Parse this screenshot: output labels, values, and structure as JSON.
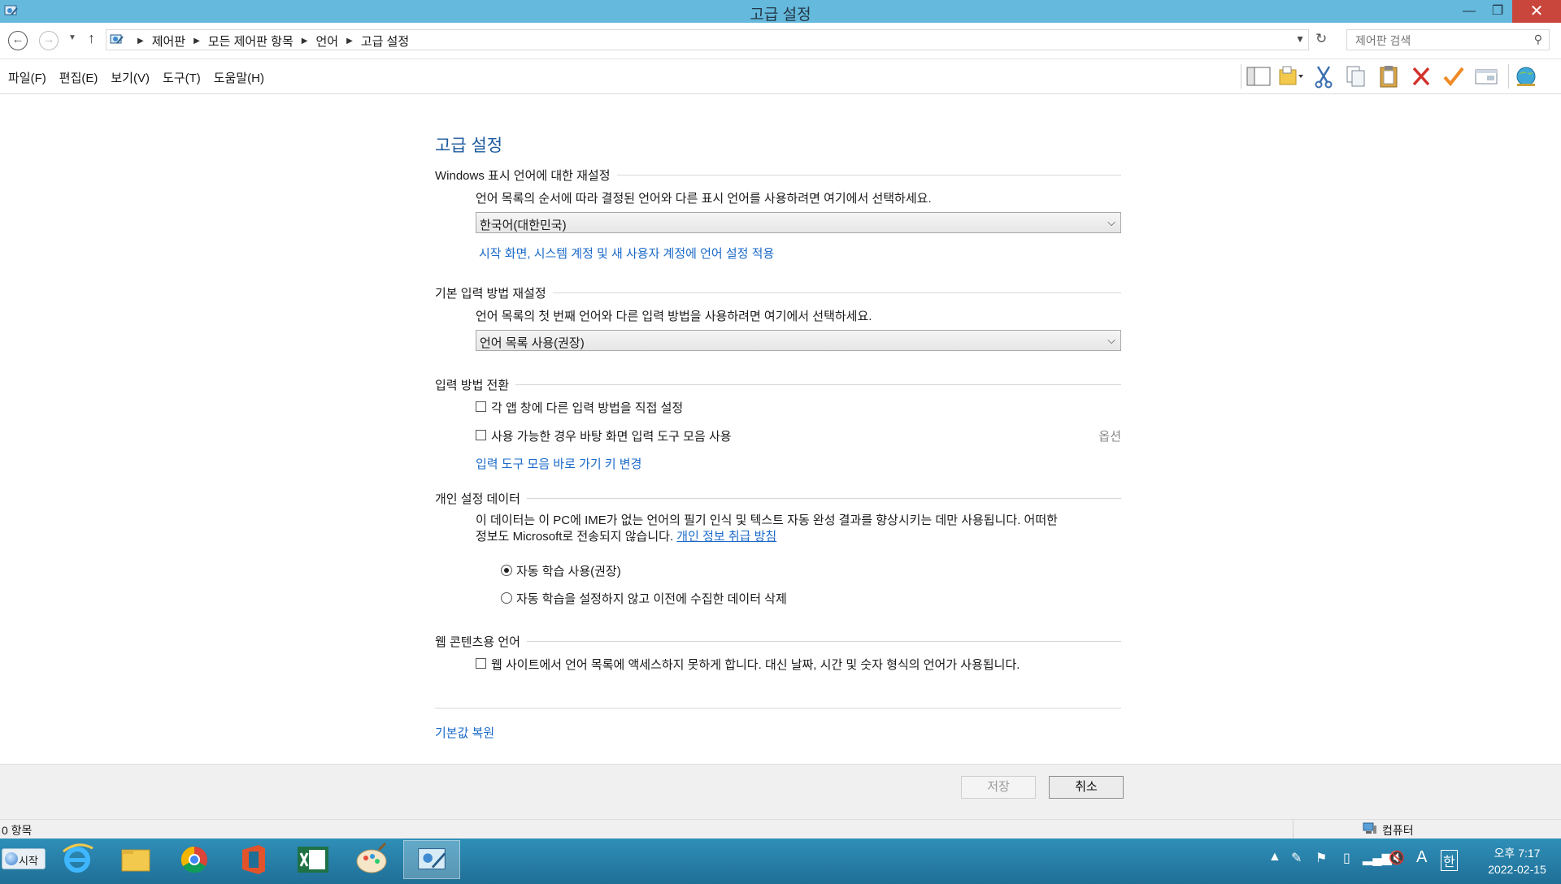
{
  "window": {
    "title": "고급 설정"
  },
  "address": {
    "crumbs": [
      "제어판",
      "모든 제어판 항목",
      "언어",
      "고급 설정"
    ],
    "search_placeholder": "제어판 검색"
  },
  "menu": [
    "파일(F)",
    "편집(E)",
    "보기(V)",
    "도구(T)",
    "도움말(H)"
  ],
  "toolbar_icons": [
    "layout-icon",
    "folder-view-icon",
    "cut-icon",
    "copy-icon",
    "paste-icon",
    "delete-icon",
    "check-icon",
    "properties-icon",
    "globe-icon"
  ],
  "page": {
    "title": "고급 설정",
    "display_language": {
      "heading": "Windows 표시 언어에 대한 재설정",
      "description": "언어 목록의 순서에 따라 결정된 언어와 다른 표시 언어를 사용하려면 여기에서 선택하세요.",
      "selected": "한국어(대한민국)",
      "apply_link": "시작 화면, 시스템 계정 및 새 사용자 계정에 언어 설정 적용"
    },
    "input_method": {
      "heading": "기본 입력 방법 재설정",
      "description": "언어 목록의 첫 번째 언어와 다른 입력 방법을 사용하려면 여기에서 선택하세요.",
      "selected": "언어 목록 사용(권장)"
    },
    "switching": {
      "heading": "입력 방법 전환",
      "per_app_label": "각 앱 창에 다른 입력 방법을 직접 설정",
      "per_app_checked": false,
      "desktop_bar_label": "사용 가능한 경우 바탕 화면 입력 도구 모음 사용",
      "desktop_bar_checked": false,
      "options_text": "옵션",
      "hotkey_link": "입력 도구 모음 바로 가기 키 변경"
    },
    "personalization": {
      "heading": "개인 설정 데이터",
      "description_line1": "이 데이터는 이 PC에 IME가 없는 언어의 필기 인식 및 텍스트 자동 완성 결과를 향상시키는 데만 사용됩니다. 어떠한",
      "description_line2": "정보도 Microsoft로 전송되지 않습니다.",
      "privacy_link": "개인 정보 취급 방침",
      "radio_auto": "자동 학습 사용(권장)",
      "radio_auto_selected": true,
      "radio_off": "자동 학습을 설정하지 않고 이전에 수집한 데이터 삭제",
      "radio_off_selected": false
    },
    "web_content": {
      "heading": "웹 콘텐츠용 언어",
      "block_label": "웹 사이트에서 언어 목록에 액세스하지 못하게 합니다. 대신 날짜, 시간 및 숫자 형식의 언어가 사용됩니다.",
      "block_checked": false
    },
    "restore_link": "기본값 복원"
  },
  "buttons": {
    "save": "저장",
    "cancel": "취소"
  },
  "status": {
    "count": "0 항목",
    "zone": "컴퓨터"
  },
  "taskbar": {
    "start": "시작",
    "apps": [
      "internet-explorer-icon",
      "file-explorer-icon",
      "chrome-icon",
      "office-icon",
      "excel-icon",
      "paint-icon",
      "control-panel-icon"
    ],
    "ime_mode": "A",
    "ime_lang": "한",
    "time": "오후 7:17",
    "date": "2022-02-15"
  }
}
